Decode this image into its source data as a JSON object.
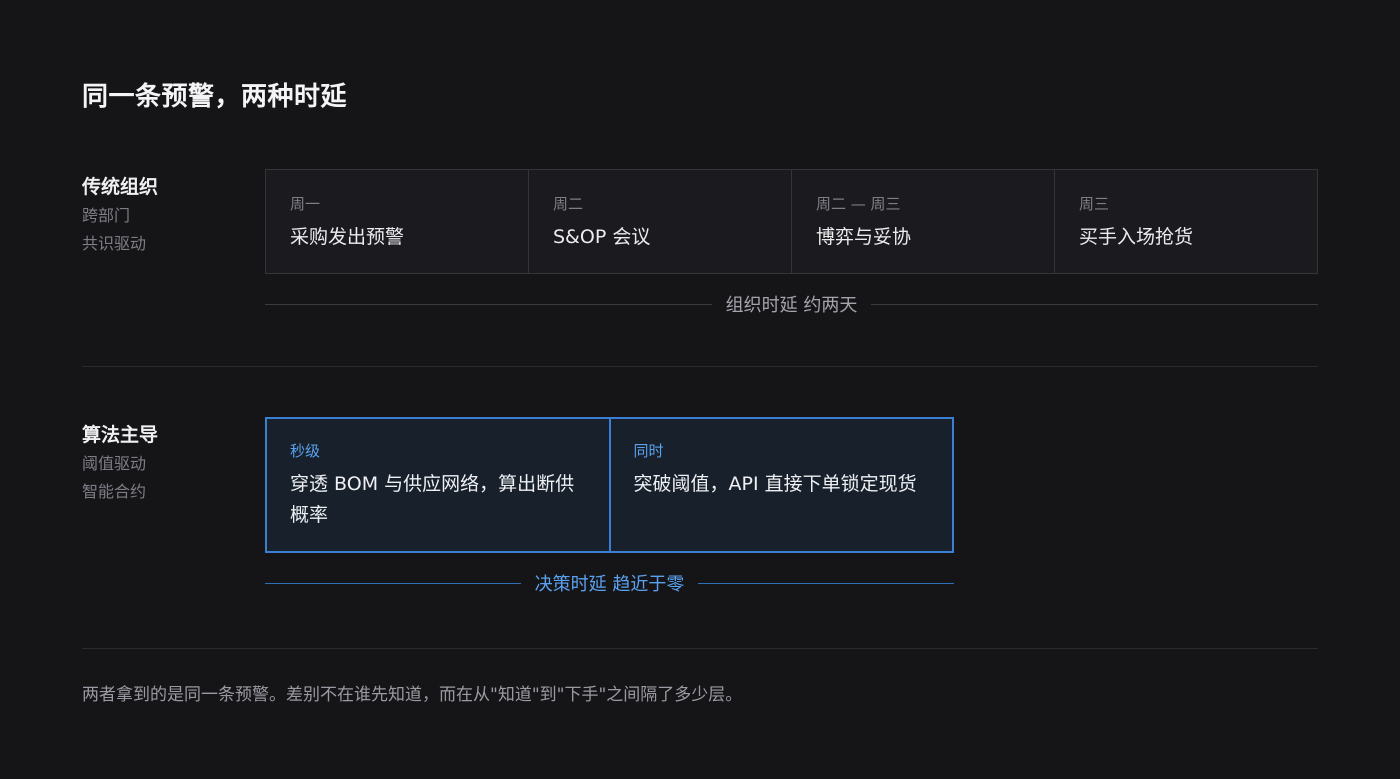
{
  "title": "同一条预警，两种时延",
  "traditional": {
    "name": "传统组织",
    "subtitle": [
      "跨部门",
      "共识驱动"
    ],
    "steps": [
      {
        "when": "周一",
        "what": "采购发出预警"
      },
      {
        "when": "周二",
        "what": "S&OP 会议"
      },
      {
        "when": "周二 — 周三",
        "what": "博弈与妥协"
      },
      {
        "when": "周三",
        "what": "买手入场抢货"
      }
    ],
    "latency": "组织时延 约两天"
  },
  "algorithmic": {
    "name": "算法主导",
    "subtitle": [
      "阈值驱动",
      "智能合约"
    ],
    "steps": [
      {
        "when": "秒级",
        "what": "穿透 BOM 与供应网络，算出断供概率"
      },
      {
        "when": "同时",
        "what": "突破阈值，API 直接下单锁定现货"
      }
    ],
    "latency": "决策时延 趋近于零"
  },
  "footnote": "两者拿到的是同一条预警。差别不在谁先知道，而在从\"知道\"到\"下手\"之间隔了多少层。",
  "colors": {
    "background": "#151518",
    "accent_blue": "#3b7fd4",
    "accent_text_blue": "#5aa2ef"
  }
}
